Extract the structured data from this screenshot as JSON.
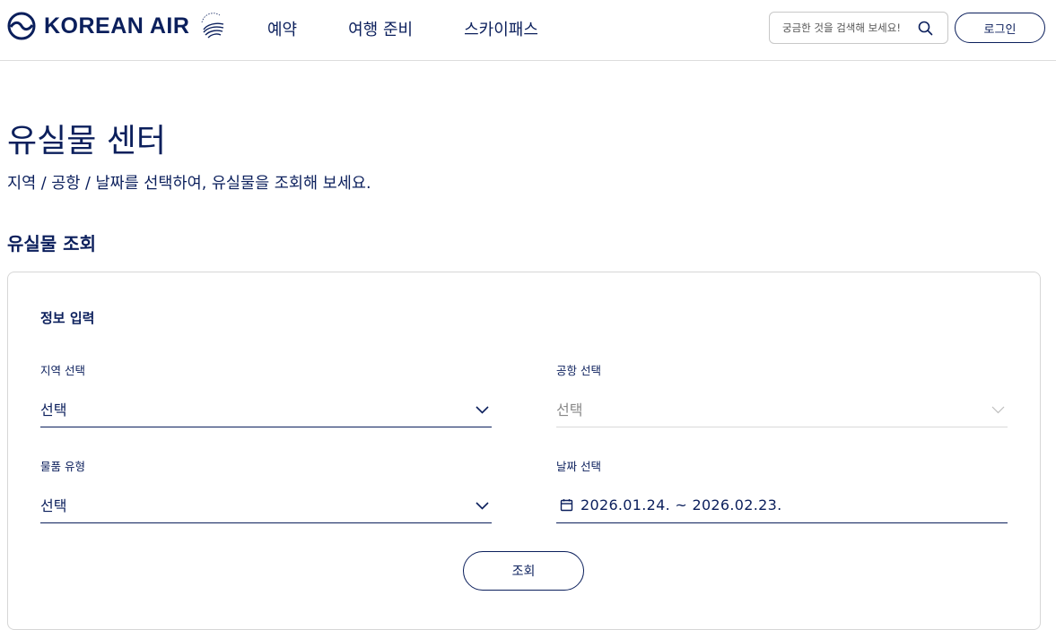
{
  "header": {
    "logo_text": "KOREAN AIR",
    "logo_icon": "korean-air-taeguk-symbol",
    "alliance_icon": "skyteam-logo",
    "nav": [
      "예약",
      "여행 준비",
      "스카이패스"
    ],
    "search_placeholder": "궁금한 것을 검색해 보세요!",
    "search_icon": "search-icon",
    "login_label": "로그인"
  },
  "page": {
    "title": "유실물 센터",
    "description": "지역 / 공항 / 날짜를 선택하여, 유실물을 조회해 보세요.",
    "section_title": "유실물 조회"
  },
  "form": {
    "title": "정보 입력",
    "region": {
      "label": "지역 선택",
      "value": "선택"
    },
    "airport": {
      "label": "공항 선택",
      "value": "선택",
      "disabled": true
    },
    "item_type": {
      "label": "물품 유형",
      "value": "선택"
    },
    "date": {
      "label": "날짜 선택",
      "value": "2026.01.24. ~ 2026.02.23."
    },
    "submit_label": "조회"
  },
  "colors": {
    "primary": "#0b1f5c",
    "border": "#d6d6d6",
    "disabled_border": "#d9d9d9"
  }
}
